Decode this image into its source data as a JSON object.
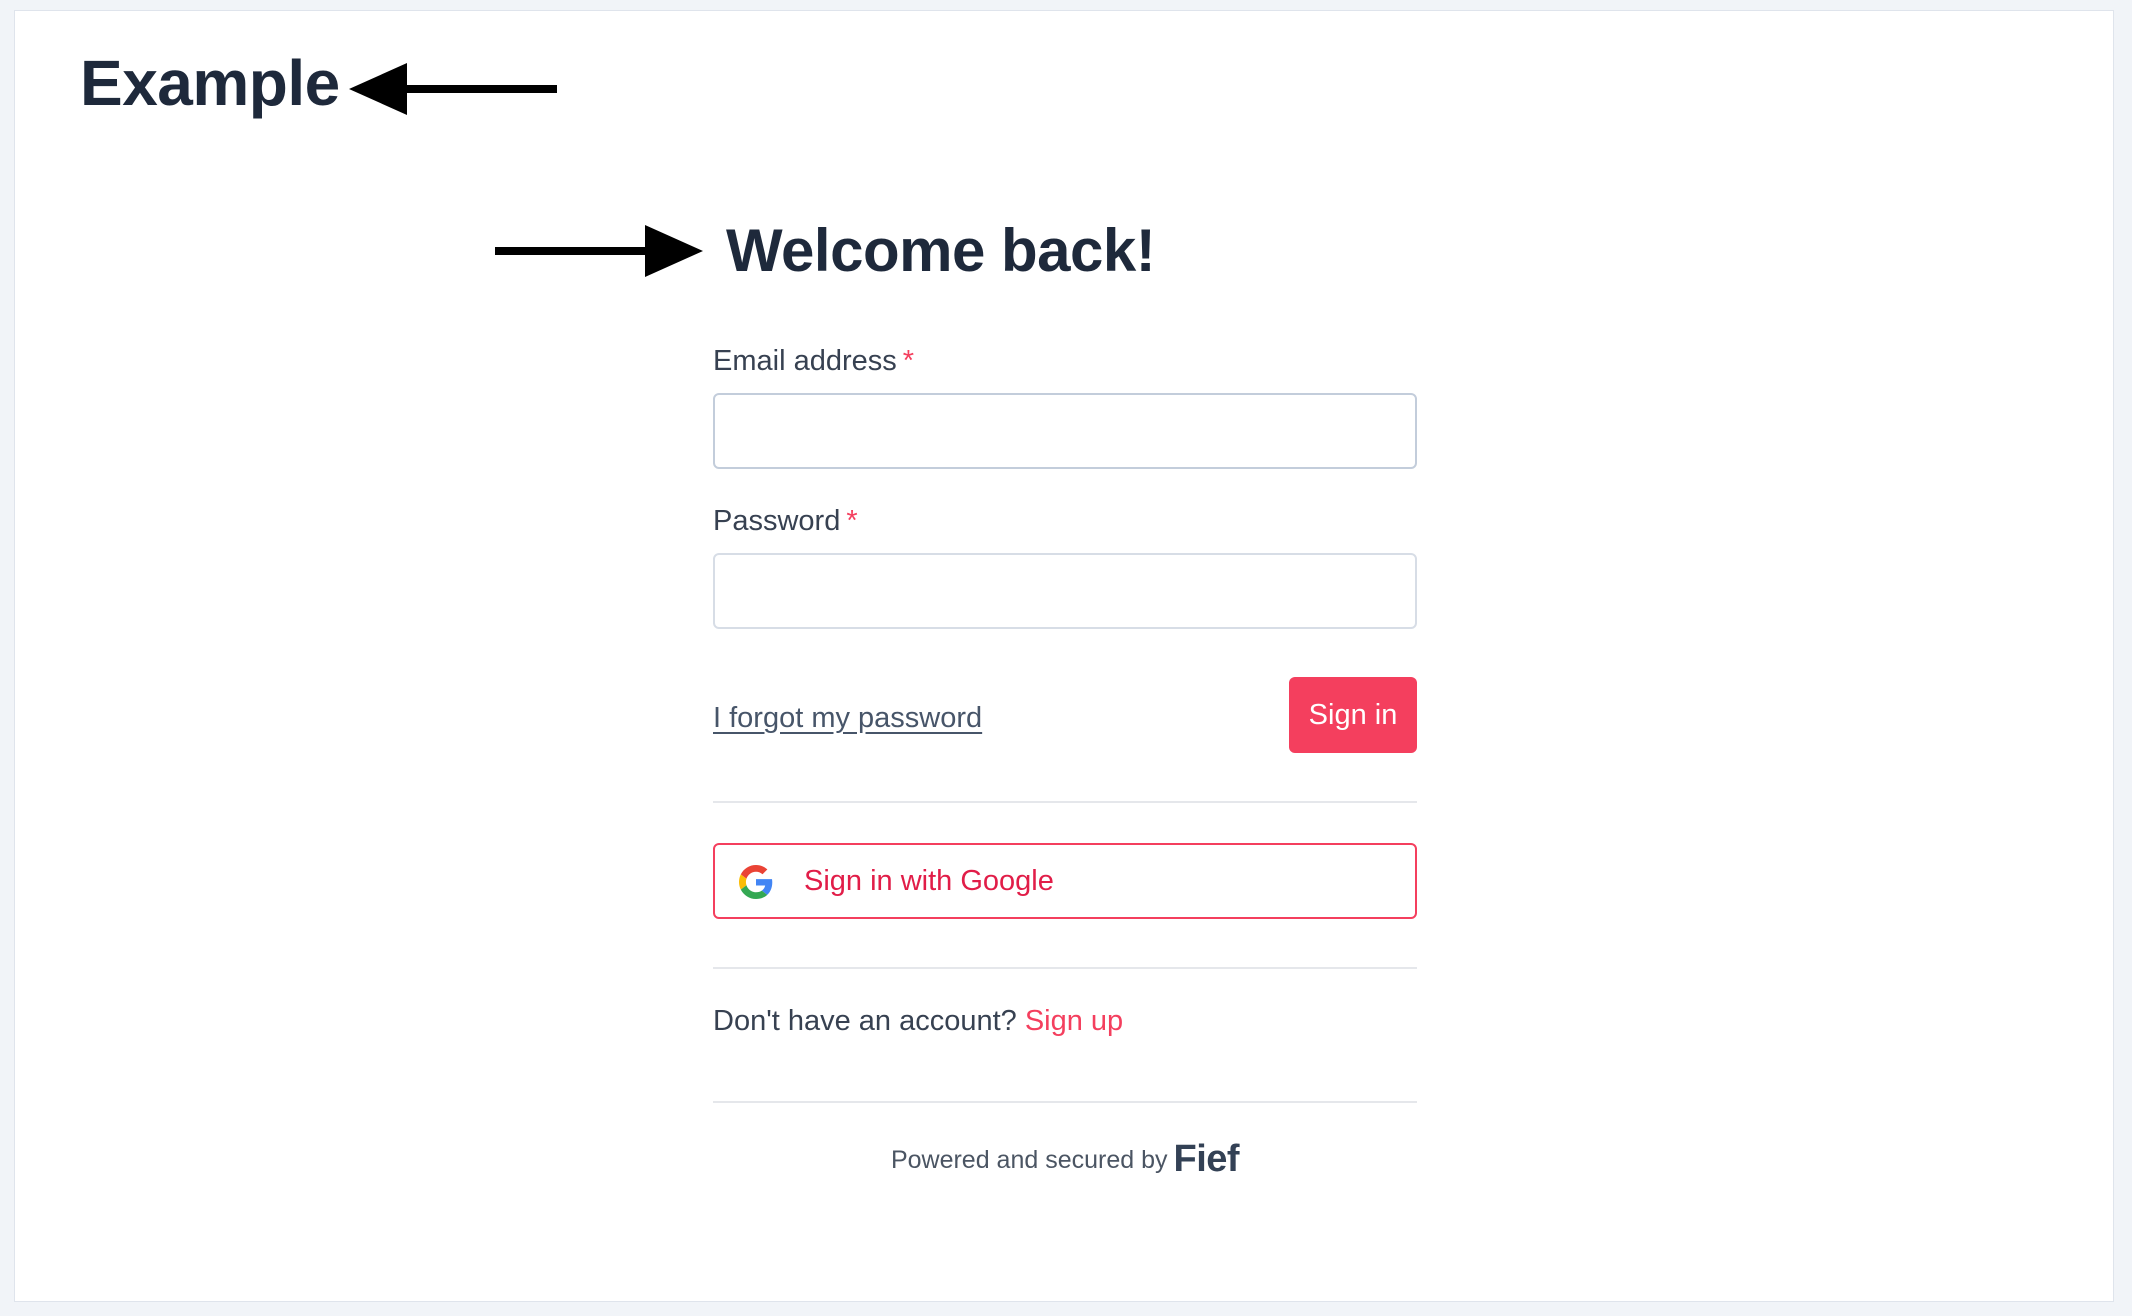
{
  "tenant": {
    "name": "Example"
  },
  "login": {
    "heading": "Welcome back!",
    "email_label": "Email address",
    "password_label": "Password",
    "required_marker": "*",
    "email_value": "",
    "password_value": "",
    "forgot_link": "I forgot my password",
    "signin_button": "Sign in",
    "google_button": "Sign in with Google",
    "google_icon": "google-g-icon",
    "signup_prompt": "Don't have an account?",
    "signup_link": "Sign up"
  },
  "footer": {
    "powered_text": "Powered and secured by",
    "brand": "Fief"
  },
  "annotations": {
    "arrow_1": "arrow-left-icon",
    "arrow_2": "arrow-right-icon"
  },
  "colors": {
    "accent": "#f43f5e",
    "heading": "#1e293b",
    "background": "#f1f4f8"
  }
}
